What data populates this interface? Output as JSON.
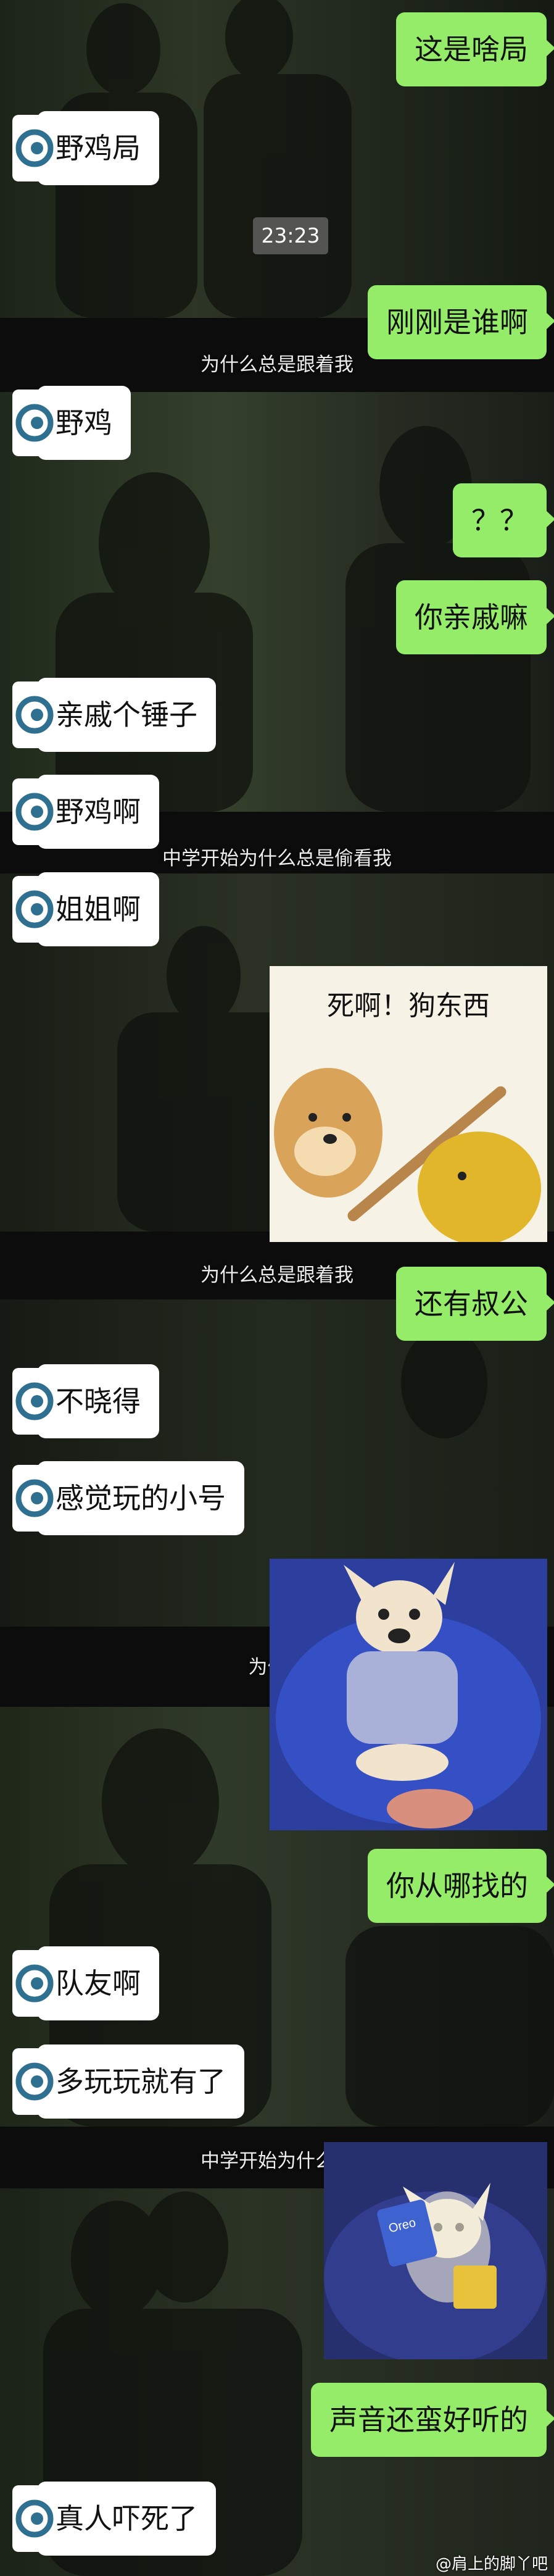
{
  "messages": [
    {
      "side": "right",
      "text": "这是啥局"
    },
    {
      "side": "left",
      "text": "野鸡局"
    },
    {
      "side": "right",
      "text": "刚刚是谁啊"
    },
    {
      "side": "left",
      "text": "野鸡"
    },
    {
      "side": "right",
      "text": "？？"
    },
    {
      "side": "right",
      "text": "你亲戚嘛"
    },
    {
      "side": "left",
      "text": "亲戚个锤子"
    },
    {
      "side": "left",
      "text": "野鸡啊"
    },
    {
      "side": "left",
      "text": "姐姐啊"
    },
    {
      "side": "right",
      "text": "还有叔公"
    },
    {
      "side": "left",
      "text": "不晓得"
    },
    {
      "side": "left",
      "text": "感觉玩的小号"
    },
    {
      "side": "right",
      "text": "你从哪找的"
    },
    {
      "side": "left",
      "text": "队友啊"
    },
    {
      "side": "left",
      "text": "多玩玩就有了"
    },
    {
      "side": "right",
      "text": "声音还蛮好听的"
    },
    {
      "side": "left",
      "text": "真人吓死了"
    }
  ],
  "timestamp": "23:23",
  "subtitles": {
    "s1": "为什么总是跟着我",
    "s2": "中学开始为什么总是偷看我",
    "s3": "为什么总是跟着我",
    "s4": "为什么",
    "s5": "中学开始为什么总"
  },
  "stickers": {
    "doge_caption": "死啊！狗东西",
    "snack_label": "Oreo"
  },
  "watermark": "@肩上的脚丫吧",
  "colors": {
    "outgoing_bubble": "#95ec69",
    "incoming_bubble": "#ffffff",
    "background": "#141812"
  }
}
